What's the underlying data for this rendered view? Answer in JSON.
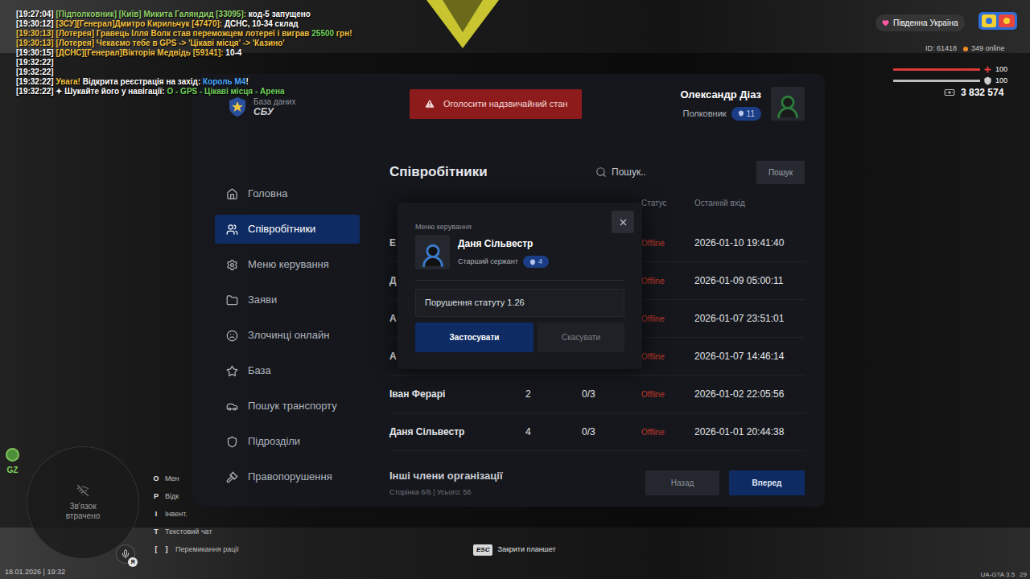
{
  "chat": [
    {
      "parts": [
        {
          "text": "[19:27:04] ",
          "color": "#ffffff"
        },
        {
          "text": "[Підполковник] [Київ] Микита Галяндид [33095]:",
          "color": "#8fd16a"
        },
        {
          "text": " код-5 запущено",
          "color": "#ffffff"
        }
      ]
    },
    {
      "parts": [
        {
          "text": "[19:30:12] ",
          "color": "#ffffff"
        },
        {
          "text": "[ЗСУ][Генерал]Дмитро Кирильчук [47470]:",
          "color": "#f0c040"
        },
        {
          "text": " ДСНС, 10-34 склад",
          "color": "#ffffff"
        }
      ]
    },
    {
      "parts": [
        {
          "text": "[19:30:13] [Лотерея] Гравець Ілля Волк став переможцем лотереї і виграв ",
          "color": "#f0c040"
        },
        {
          "text": "25500",
          "color": "#6fd05a"
        },
        {
          "text": " грн!",
          "color": "#f0c040"
        }
      ]
    },
    {
      "parts": [
        {
          "text": "[19:30:13] [Лотерея] Чекаємо тебе в GPS -> 'Цікаві місця' -> 'Казино'",
          "color": "#f0c040"
        }
      ]
    },
    {
      "parts": [
        {
          "text": "[19:30:15] ",
          "color": "#ffffff"
        },
        {
          "text": "[ДСНС][Генерал]Вікторія Медвідь [59141]:",
          "color": "#f0c040"
        },
        {
          "text": " 10-4",
          "color": "#ffffff"
        }
      ]
    },
    {
      "parts": [
        {
          "text": "[19:32:22]",
          "color": "#ffffff"
        }
      ]
    },
    {
      "parts": [
        {
          "text": "[19:32:22]",
          "color": "#ffffff"
        }
      ]
    },
    {
      "parts": [
        {
          "text": "[19:32:22] ",
          "color": "#ffffff"
        },
        {
          "text": "Увага!",
          "color": "#f0c040"
        },
        {
          "text": " Відкрита реєстрація на захід: ",
          "color": "#ffffff"
        },
        {
          "text": "Король М4",
          "color": "#4aa8ff"
        },
        {
          "text": "!",
          "color": "#ffffff"
        }
      ]
    },
    {
      "parts": [
        {
          "text": "[19:32:22] ✦ Шукайте його у навігації: ",
          "color": "#ffffff"
        },
        {
          "text": "О - GPS - Цікаві місця - Арена",
          "color": "#6fd05a"
        }
      ]
    }
  ],
  "server": {
    "region": "Південна Україна",
    "id": "ID: 61418",
    "online": "349 online"
  },
  "stats": {
    "health": {
      "value": "100",
      "level": 1
    },
    "armor": {
      "value": "100",
      "level": 1
    },
    "money": "3 832 574"
  },
  "tablet": {
    "logo": {
      "title": "База даних",
      "subtitle": "СБУ"
    },
    "emergency_button": "Оголосити надзвичайний стан",
    "user": {
      "name": "Олександр Діаз",
      "rank": "Полковник",
      "level": "11"
    },
    "sidebar": {
      "items": [
        {
          "label": "Головна",
          "selected": false
        },
        {
          "label": "Співробітники",
          "selected": true
        },
        {
          "label": "Меню керування",
          "selected": false
        },
        {
          "label": "Заяви",
          "selected": false
        },
        {
          "label": "Злочинці онлайн",
          "selected": false
        },
        {
          "label": "База",
          "selected": false
        },
        {
          "label": "Пошук транспорту",
          "selected": false
        },
        {
          "label": "Підрозділи",
          "selected": false
        },
        {
          "label": "Правопорушення",
          "selected": false
        }
      ]
    },
    "page_title": "Співробітники",
    "search": {
      "placeholder": "Пошук..",
      "button": "Пошук"
    },
    "table": {
      "columns": [
        "",
        "",
        "",
        "Статус",
        "Останній вхід"
      ],
      "rows": [
        {
          "name": "Е",
          "rank": "",
          "warnings": "",
          "status": "Offline",
          "last_login": "2026-01-10 19:41:40",
          "color": "#c0392b"
        },
        {
          "name": "Д",
          "rank": "",
          "warnings": "",
          "status": "Offline",
          "last_login": "2026-01-09 05:00:11",
          "color": "#c0392b"
        },
        {
          "name": "А",
          "rank": "",
          "warnings": "",
          "status": "Offline",
          "last_login": "2026-01-07 23:51:01",
          "color": "#c0392b"
        },
        {
          "name": "А",
          "rank": "",
          "warnings": "",
          "status": "Offline",
          "last_login": "2026-01-07 14:46:14",
          "color": "#c0392b"
        },
        {
          "name": "Іван Ферарі",
          "rank": "2",
          "warnings": "0/3",
          "status": "Offline",
          "last_login": "2026-01-02 22:05:56",
          "color": "#c0392b"
        },
        {
          "name": "Даня Сільвестр",
          "rank": "4",
          "warnings": "0/3",
          "status": "Offline",
          "last_login": "2026-01-01 20:44:38",
          "color": "#c0392b"
        }
      ]
    },
    "footer": {
      "title": "Інші члени організації",
      "page_info": "Сторінка 6/6 | Усього: 56",
      "prev": "Назад",
      "next": "Вперед"
    },
    "modal": {
      "title": "Меню керування",
      "member": {
        "name": "Даня Сільвестр",
        "rank": "Старший сержант",
        "level": "4"
      },
      "reason": "Порушення статуту 1.26",
      "apply": "Застосувати",
      "cancel": "Скасувати"
    }
  },
  "minimap": {
    "status": "Зв'язок втрачено",
    "zone": "GZ",
    "voice_badge": "Я"
  },
  "datetime": "18.01.2026 | 19:32",
  "hints": [
    {
      "keys": [
        "O"
      ],
      "label": "Мен"
    },
    {
      "keys": [
        "P"
      ],
      "label": "Відк"
    },
    {
      "keys": [
        "I"
      ],
      "label": "Інвент."
    },
    {
      "keys": [
        "T"
      ],
      "label": "Текстовий чат"
    },
    {
      "keys": [
        "[",
        "]"
      ],
      "label": "Перемикання рації"
    }
  ],
  "close_hint": {
    "key": "ESC",
    "label": "Закрити планшет"
  },
  "version": "UA-GTA 3.5",
  "fps": "29"
}
